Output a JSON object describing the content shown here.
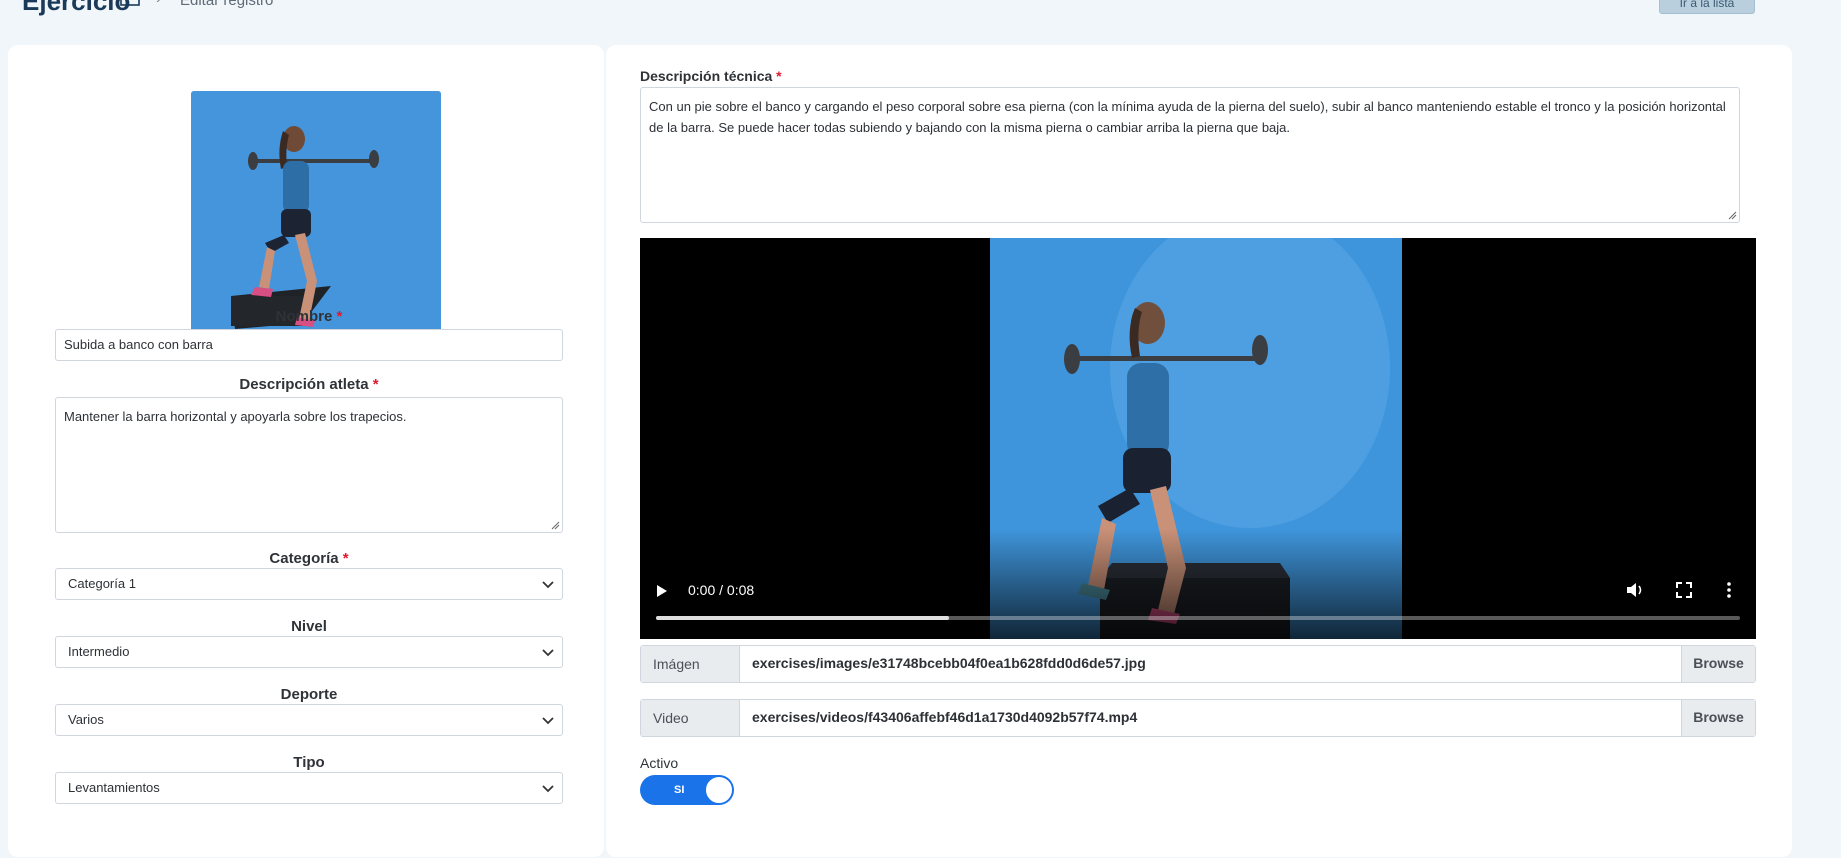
{
  "header": {
    "title": "Ejercicio",
    "breadcrumb": "Editar registro",
    "back_label": "Ir a la lista"
  },
  "left": {
    "nombre_label": "Nombre",
    "nombre_value": "Subida a banco con barra",
    "desc_atleta_label": "Descripción atleta",
    "desc_atleta_value": "Mantener la barra horizontal y apoyarla sobre los trapecios.",
    "categoria_label": "Categoría",
    "categoria_value": "Categoría 1",
    "nivel_label": "Nivel",
    "nivel_value": "Intermedio",
    "deporte_label": "Deporte",
    "deporte_value": "Varios",
    "tipo_label": "Tipo",
    "tipo_value": "Levantamientos",
    "required_mark": "*"
  },
  "right": {
    "desc_tecnica_label": "Descripción técnica",
    "desc_tecnica_value": "Con un pie sobre el banco y cargando el peso corporal sobre esa pierna (con la mínima ayuda de la pierna del suelo), subir al banco manteniendo estable el tronco y la posición horizontal de la barra. Se puede hacer todas subiendo y bajando con la misma pierna o cambiar arriba la pierna que baja.",
    "video": {
      "time": "0:00 / 0:08",
      "progress": 0.27
    },
    "imagen": {
      "label": "Imágen",
      "path": "exercises/images/e31748bcebb04f0ea1b628fdd0d6de57.jpg",
      "browse": "Browse"
    },
    "video_file": {
      "label": "Video",
      "path": "exercises/videos/f43406affebf46d1a1730d4092b57f74.mp4",
      "browse": "Browse"
    },
    "activo_label": "Activo",
    "activo_value": "SI"
  },
  "colors": {
    "accent": "#1a73e8",
    "required": "#e0182d",
    "backdrop": "#3d8fd6"
  }
}
